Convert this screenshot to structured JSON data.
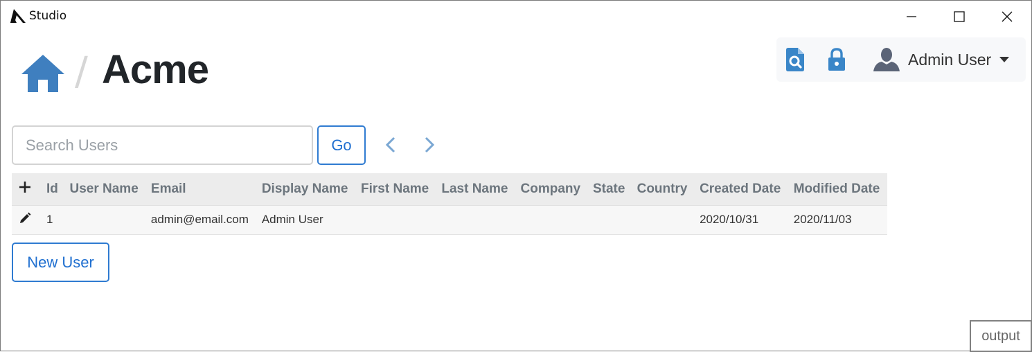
{
  "window": {
    "title": "Studio",
    "controls": [
      "minimize-icon",
      "maximize-icon",
      "close-icon"
    ]
  },
  "header": {
    "home_icon": "home-icon",
    "separator": "/",
    "title": "Acme"
  },
  "toolbar": {
    "search_icon": "document-search-icon",
    "lock_icon": "lock-icon",
    "user_icon": "user-avatar-icon",
    "user_name": "Admin User",
    "dropdown_icon": "caret-down-icon"
  },
  "search": {
    "placeholder": "Search Users",
    "value": "",
    "go_label": "Go",
    "prev_icon": "chevron-left-icon",
    "next_icon": "chevron-right-icon"
  },
  "table": {
    "add_icon": "plus-icon",
    "columns": [
      "Id",
      "User Name",
      "Email",
      "Display Name",
      "First Name",
      "Last Name",
      "Company",
      "State",
      "Country",
      "Created Date",
      "Modified Date"
    ],
    "rows": [
      {
        "edit_icon": "pencil-icon",
        "cells": [
          "1",
          "",
          "admin@email.com",
          "Admin User",
          "",
          "",
          "",
          "",
          "",
          "2020/10/31",
          "2020/11/03"
        ]
      }
    ]
  },
  "actions": {
    "new_user_label": "New User"
  },
  "output": {
    "label": "output"
  },
  "colors": {
    "accent": "#2f7bd1",
    "home_icon": "#3f7fbf",
    "toolbar_icon": "#3a86c8",
    "header_bg": "#ececec",
    "row_bg": "#f7f7f7",
    "toolbar_bg": "#f7f8fa"
  }
}
